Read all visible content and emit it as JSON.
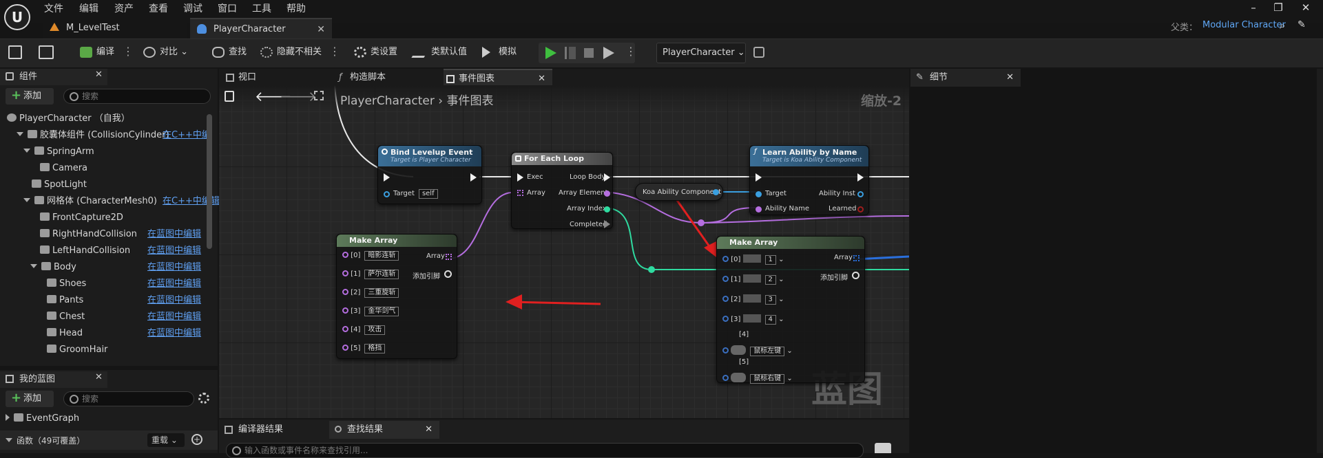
{
  "menu": [
    "文件",
    "编辑",
    "资产",
    "查看",
    "调试",
    "窗口",
    "工具",
    "帮助"
  ],
  "tabs": [
    {
      "label": "M_LevelTest"
    },
    {
      "label": "PlayerCharacter"
    }
  ],
  "parent": {
    "label": "父类：",
    "value": "Modular Character"
  },
  "toolbar": {
    "compile": "编译",
    "diff": "对比",
    "find": "查找",
    "hide_unrelated": "隐藏不相关",
    "class_settings": "类设置",
    "class_defaults": "类默认值",
    "simulate": "模拟",
    "character_select": "PlayerCharacter"
  },
  "components": {
    "title": "组件",
    "add": "添加",
    "search_placeholder": "搜索",
    "items": [
      {
        "label": "PlayerCharacter （自我）"
      },
      {
        "label": "胶囊体组件 (CollisionCylinder)",
        "edit": "在C++中编"
      },
      {
        "label": "SpringArm"
      },
      {
        "label": "Camera"
      },
      {
        "label": "SpotLight"
      },
      {
        "label": "网格体 (CharacterMesh0)",
        "edit": "在C++中编辑"
      },
      {
        "label": "FrontCapture2D"
      },
      {
        "label": "RightHandCollision",
        "edit": "在蓝图中编辑"
      },
      {
        "label": "LeftHandCollision",
        "edit": "在蓝图中编辑"
      },
      {
        "label": "Body",
        "edit": "在蓝图中编辑"
      },
      {
        "label": "Shoes",
        "edit": "在蓝图中编辑"
      },
      {
        "label": "Pants",
        "edit": "在蓝图中编辑"
      },
      {
        "label": "Chest",
        "edit": "在蓝图中编辑"
      },
      {
        "label": "Head",
        "edit": "在蓝图中编辑"
      },
      {
        "label": "GroomHair"
      }
    ]
  },
  "my_blueprint": {
    "title": "我的蓝图",
    "add": "添加",
    "search_placeholder": "搜索",
    "event_graph": "EventGraph",
    "functions": "函数（49可覆盖）",
    "override": "重载"
  },
  "graph_tabs": [
    {
      "label": "视口"
    },
    {
      "label": "构造脚本"
    },
    {
      "label": "事件图表"
    }
  ],
  "breadcrumb": {
    "root": "PlayerCharacter",
    "current": "事件图表",
    "zoom": "缩放-2"
  },
  "watermark": "蓝图",
  "nodes": {
    "bind": {
      "title": "Bind Levelup Event",
      "subtitle": "Target is Player Character",
      "target": "Target",
      "self": "self"
    },
    "foreach": {
      "title": "For Each Loop",
      "exec": "Exec",
      "array": "Array",
      "loop_body": "Loop Body",
      "array_element": "Array Element",
      "array_index": "Array Index",
      "completed": "Completed"
    },
    "koa": {
      "label": "Koa Ability Component"
    },
    "learn": {
      "title": "Learn Ability by Name",
      "subtitle": "Target is Koa Ability Component",
      "target": "Target",
      "ability_name": "Ability Name",
      "ability_inst": "Ability Inst",
      "learned": "Learned"
    },
    "make1": {
      "title": "Make Array",
      "array": "Array",
      "add_pin": "添加引脚",
      "items": [
        {
          "idx": "[0]",
          "val": "暗影连斩"
        },
        {
          "idx": "[1]",
          "val": "萨尔连斩"
        },
        {
          "idx": "[2]",
          "val": "三重旋斩"
        },
        {
          "idx": "[3]",
          "val": "金华剑气"
        },
        {
          "idx": "[4]",
          "val": "攻击"
        },
        {
          "idx": "[5]",
          "val": "格挡"
        }
      ]
    },
    "make2": {
      "title": "Make Array",
      "array": "Array",
      "add_pin": "添加引脚",
      "items": [
        {
          "idx": "[0]",
          "val": "1"
        },
        {
          "idx": "[1]",
          "val": "2"
        },
        {
          "idx": "[2]",
          "val": "3"
        },
        {
          "idx": "[3]",
          "val": "4"
        },
        {
          "idx": "[4]",
          "val": "鼠标左键"
        },
        {
          "idx": "[5]",
          "val": "鼠标右键"
        }
      ]
    }
  },
  "details": {
    "title": "细节"
  },
  "bottom": {
    "compiler": "编译器结果",
    "find": "查找结果",
    "search_placeholder": "输入函数或事件名称来查找引用..."
  }
}
